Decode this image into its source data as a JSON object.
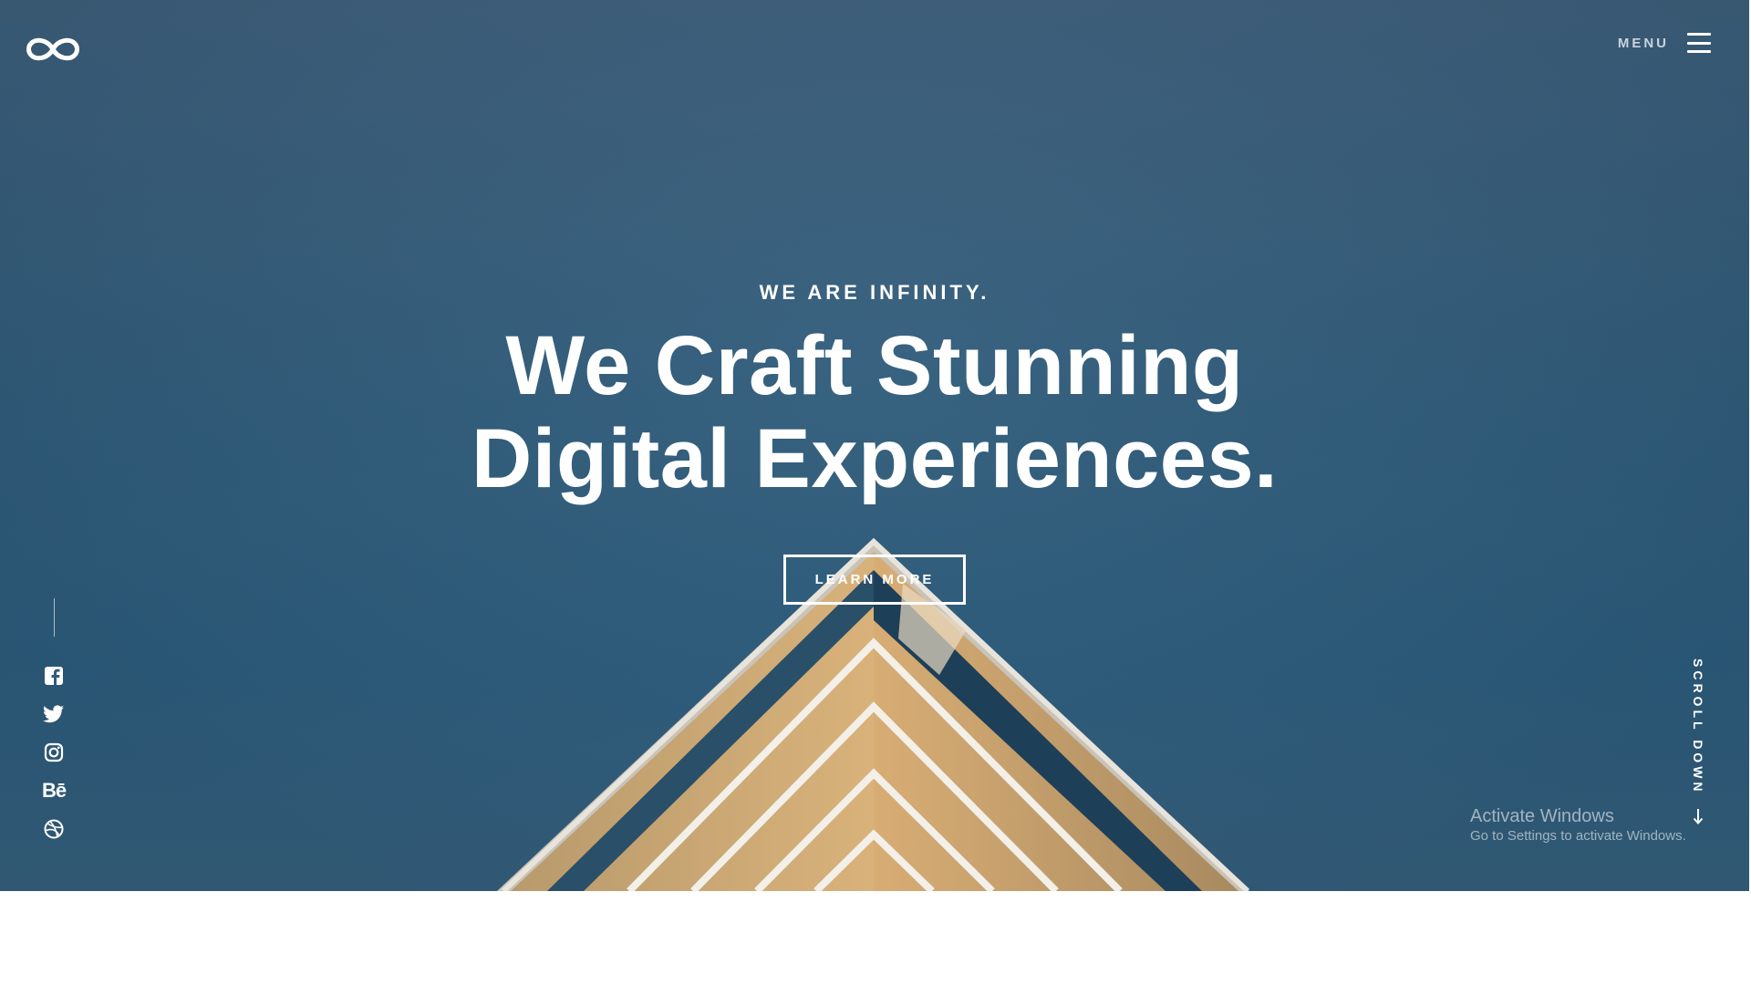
{
  "header": {
    "logo_icon": "infinity-icon",
    "menu_label": "MENU",
    "menu_icon": "hamburger-icon"
  },
  "hero": {
    "kicker": "WE ARE INFINITY.",
    "headline_line1": "We Craft Stunning",
    "headline_line2": "Digital Experiences.",
    "cta_label": "LEARN MORE",
    "background_color": "#2f5c7b"
  },
  "social": {
    "items": [
      {
        "name": "facebook",
        "icon": "facebook-icon"
      },
      {
        "name": "twitter",
        "icon": "twitter-icon"
      },
      {
        "name": "instagram",
        "icon": "instagram-icon"
      },
      {
        "name": "behance",
        "icon": "behance-icon",
        "glyph": "Bē"
      },
      {
        "name": "dribbble",
        "icon": "dribbble-icon"
      }
    ]
  },
  "scroll": {
    "label": "SCROLL DOWN",
    "icon": "arrow-down-icon"
  },
  "watermark": {
    "title": "Activate Windows",
    "subtitle": "Go to Settings to activate Windows."
  }
}
